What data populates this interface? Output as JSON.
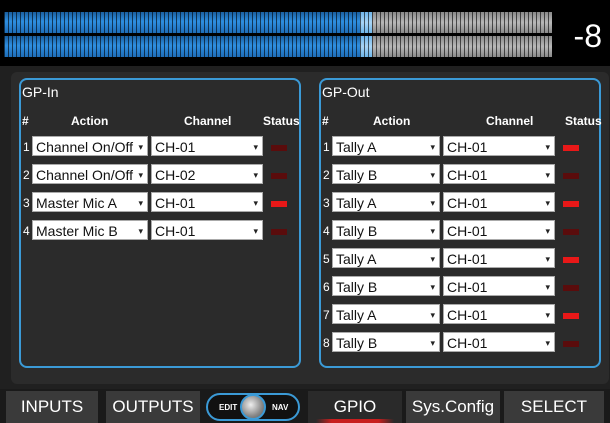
{
  "meter": {
    "readout": "-8",
    "level_fraction": 0.65
  },
  "gp_in": {
    "title": "GP-In",
    "headers": {
      "num": "#",
      "action": "Action",
      "channel": "Channel",
      "status": "Status"
    },
    "rows": [
      {
        "num": "1",
        "action": "Channel On/Off",
        "channel": "CH-01",
        "status": "off"
      },
      {
        "num": "2",
        "action": "Channel On/Off",
        "channel": "CH-02",
        "status": "off"
      },
      {
        "num": "3",
        "action": "Master Mic A",
        "channel": "CH-01",
        "status": "on"
      },
      {
        "num": "4",
        "action": "Master Mic B",
        "channel": "CH-01",
        "status": "off"
      }
    ]
  },
  "gp_out": {
    "title": "GP-Out",
    "headers": {
      "num": "#",
      "action": "Action",
      "channel": "Channel",
      "status": "Status"
    },
    "rows": [
      {
        "num": "1",
        "action": "Tally A",
        "channel": "CH-01",
        "status": "on"
      },
      {
        "num": "2",
        "action": "Tally B",
        "channel": "CH-01",
        "status": "off"
      },
      {
        "num": "3",
        "action": "Tally A",
        "channel": "CH-01",
        "status": "on"
      },
      {
        "num": "4",
        "action": "Tally B",
        "channel": "CH-01",
        "status": "off"
      },
      {
        "num": "5",
        "action": "Tally A",
        "channel": "CH-01",
        "status": "on"
      },
      {
        "num": "6",
        "action": "Tally B",
        "channel": "CH-01",
        "status": "off"
      },
      {
        "num": "7",
        "action": "Tally A",
        "channel": "CH-01",
        "status": "on"
      },
      {
        "num": "8",
        "action": "Tally B",
        "channel": "CH-01",
        "status": "off"
      }
    ]
  },
  "nav": {
    "inputs": "INPUTS",
    "outputs": "OUTPUTS",
    "edit": "EDIT",
    "nav": "NAV",
    "gpio": "GPIO",
    "sysconfig": "Sys.Config",
    "select": "SELECT",
    "active": "GPIO"
  },
  "colors": {
    "accent": "#3b9ad6",
    "led_on": "#e81818",
    "led_off": "#5a0c0c"
  }
}
